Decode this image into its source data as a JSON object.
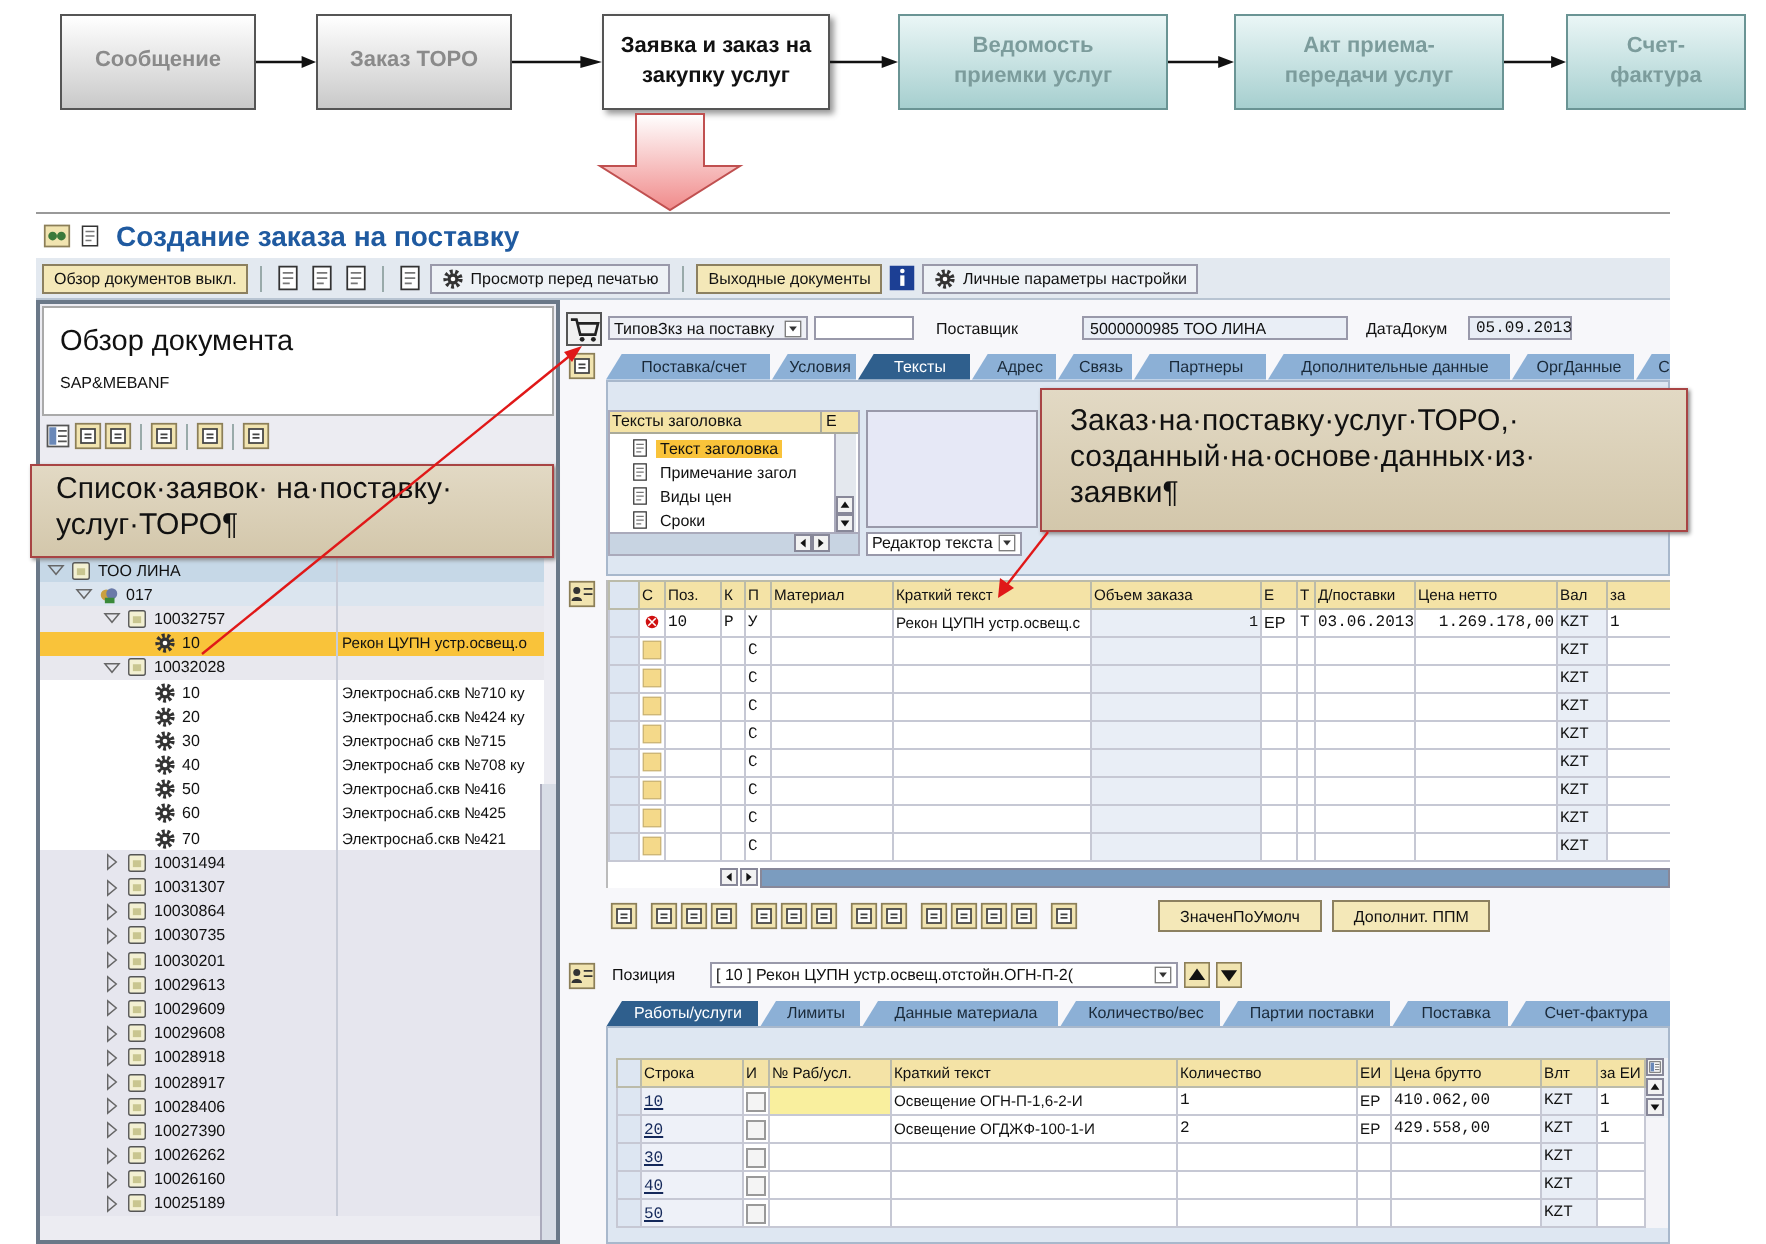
{
  "process_flow": [
    {
      "label": "Сообщение",
      "kind": "done"
    },
    {
      "label": "Заказ ТОРО",
      "kind": "done"
    },
    {
      "label": "Заявка и заказ на закупку услуг",
      "kind": "current"
    },
    {
      "label": "Ведомость приемки услуг",
      "kind": "next"
    },
    {
      "label": "Акт приема-передачи услуг",
      "kind": "next"
    },
    {
      "label": "Счет-фактура",
      "kind": "next"
    }
  ],
  "window": {
    "title": "Создание заказа на поставку"
  },
  "toolbar": [
    {
      "kind": "button",
      "label": "Обзор документов выкл."
    },
    {
      "kind": "separator"
    },
    {
      "kind": "icon"
    },
    {
      "kind": "icon"
    },
    {
      "kind": "icon"
    },
    {
      "kind": "separator"
    },
    {
      "kind": "icon"
    },
    {
      "kind": "icon_button",
      "label": "Просмотр перед печатью"
    },
    {
      "kind": "separator"
    },
    {
      "kind": "button",
      "label": "Выходные документы"
    },
    {
      "kind": "info"
    },
    {
      "kind": "icon_button",
      "label": "Личные параметры настройки"
    }
  ],
  "overview": {
    "title": "Обзор документа",
    "subtitle": "SAP&MEBANF"
  },
  "tree": [
    {
      "label": "ТОО ЛИНА",
      "kind": "vendor",
      "expanded": true,
      "children": [
        {
          "label": "017",
          "kind": "group",
          "expanded": true,
          "children": [
            {
              "label": "10032757",
              "kind": "doc",
              "expanded": true,
              "children": [
                {
                  "label": "10",
                  "kind": "item",
                  "selected": true,
                  "text": "Рекон ЦУПН устр.освещ.о"
                }
              ]
            },
            {
              "label": "10032028",
              "kind": "doc",
              "expanded": true,
              "children": [
                {
                  "label": "10",
                  "kind": "item",
                  "selected": false,
                  "text": "Электроснаб.скв №710 ку"
                },
                {
                  "label": "20",
                  "kind": "item",
                  "selected": false,
                  "text": "Электроснаб.скв №424 ку"
                },
                {
                  "label": "30",
                  "kind": "item",
                  "selected": false,
                  "text": "Электроснаб скв №715"
                },
                {
                  "label": "40",
                  "kind": "item",
                  "selected": false,
                  "text": "Электроснаб скв №708 ку"
                },
                {
                  "label": "50",
                  "kind": "item",
                  "selected": false,
                  "text": "Электроснаб.скв №416"
                },
                {
                  "label": "60",
                  "kind": "item",
                  "selected": false,
                  "text": "Электроснаб.скв №425"
                },
                {
                  "label": "70",
                  "kind": "item",
                  "selected": false,
                  "text": "Электроснаб.скв №421"
                }
              ]
            },
            {
              "label": "10031494",
              "kind": "doc",
              "expanded": false
            },
            {
              "label": "10031307",
              "kind": "doc",
              "expanded": false
            },
            {
              "label": "10030864",
              "kind": "doc",
              "expanded": false
            },
            {
              "label": "10030735",
              "kind": "doc",
              "expanded": false
            },
            {
              "label": "10030201",
              "kind": "doc",
              "expanded": false
            },
            {
              "label": "10029613",
              "kind": "doc",
              "expanded": false
            },
            {
              "label": "10029609",
              "kind": "doc",
              "expanded": false
            },
            {
              "label": "10029608",
              "kind": "doc",
              "expanded": false
            },
            {
              "label": "10028918",
              "kind": "doc",
              "expanded": false
            },
            {
              "label": "10028917",
              "kind": "doc",
              "expanded": false
            },
            {
              "label": "10028406",
              "kind": "doc",
              "expanded": false
            },
            {
              "label": "10027390",
              "kind": "doc",
              "expanded": false
            },
            {
              "label": "10026262",
              "kind": "doc",
              "expanded": false
            },
            {
              "label": "10026160",
              "kind": "doc",
              "expanded": false
            },
            {
              "label": "10025189",
              "kind": "doc",
              "expanded": false
            }
          ]
        }
      ]
    }
  ],
  "header": {
    "doc_type": "ТиповЗкз на поставку",
    "vendor_label": "Поставщик",
    "vendor": "5000000985 ТОО ЛИНА",
    "date_label": "ДатаДокум",
    "date": "05.09.2013"
  },
  "header_tabs": [
    {
      "label": "Поставка/счет",
      "selected": false
    },
    {
      "label": "Условия",
      "selected": false
    },
    {
      "label": "Тексты",
      "selected": true
    },
    {
      "label": "Адрес",
      "selected": false
    },
    {
      "label": "Связь",
      "selected": false
    },
    {
      "label": "Партнеры",
      "selected": false
    },
    {
      "label": "Дополнительные данные",
      "selected": false
    },
    {
      "label": "ОргДанные",
      "selected": false
    },
    {
      "label": "С",
      "selected": false
    }
  ],
  "header_texts": {
    "columns": [
      "Тексты заголовка",
      "Е"
    ],
    "items": [
      {
        "label": "Текст заголовка",
        "selected": true
      },
      {
        "label": "Примечание загол",
        "selected": false
      },
      {
        "label": "Виды цен",
        "selected": false
      },
      {
        "label": "Сроки",
        "selected": false
      }
    ],
    "editor": "Редактор текста"
  },
  "items_table": {
    "columns": [
      "С",
      "Поз.",
      "К",
      "П",
      "Материал",
      "Краткий текст",
      "Объем заказа",
      "Е",
      "Т",
      "Д/поставки",
      "Цена нетто",
      "Вал",
      "за"
    ],
    "rows": [
      {
        "alert": true,
        "cells": [
          "",
          "10",
          "Р",
          "У",
          "",
          "Рекон ЦУПН устр.освещ.с",
          "1",
          "ЕР",
          "Т",
          "03.06.2013",
          "1.269.178,00",
          "KZT",
          "1"
        ]
      },
      {
        "alert": false,
        "cells": [
          "",
          "",
          "",
          "С",
          "",
          "",
          "",
          "",
          "",
          "",
          "",
          "KZT",
          ""
        ]
      },
      {
        "alert": false,
        "cells": [
          "",
          "",
          "",
          "С",
          "",
          "",
          "",
          "",
          "",
          "",
          "",
          "KZT",
          ""
        ]
      },
      {
        "alert": false,
        "cells": [
          "",
          "",
          "",
          "С",
          "",
          "",
          "",
          "",
          "",
          "",
          "",
          "KZT",
          ""
        ]
      },
      {
        "alert": false,
        "cells": [
          "",
          "",
          "",
          "С",
          "",
          "",
          "",
          "",
          "",
          "",
          "",
          "KZT",
          ""
        ]
      },
      {
        "alert": false,
        "cells": [
          "",
          "",
          "",
          "С",
          "",
          "",
          "",
          "",
          "",
          "",
          "",
          "KZT",
          ""
        ]
      },
      {
        "alert": false,
        "cells": [
          "",
          "",
          "",
          "С",
          "",
          "",
          "",
          "",
          "",
          "",
          "",
          "KZT",
          ""
        ]
      },
      {
        "alert": false,
        "cells": [
          "",
          "",
          "",
          "С",
          "",
          "",
          "",
          "",
          "",
          "",
          "",
          "KZT",
          ""
        ]
      },
      {
        "alert": false,
        "cells": [
          "",
          "",
          "",
          "С",
          "",
          "",
          "",
          "",
          "",
          "",
          "",
          "KZT",
          ""
        ]
      }
    ]
  },
  "item_actions": [
    "ЗначенПоУмолч",
    "Дополнит. ППМ"
  ],
  "position": {
    "label": "Позиция",
    "value": "[ 10 ] Рекон ЦУПН устр.освещ.отстойн.ОГН-П-2("
  },
  "item_tabs": [
    {
      "label": "Работы/услуги",
      "selected": true
    },
    {
      "label": "Лимиты",
      "selected": false
    },
    {
      "label": "Данные материала",
      "selected": false
    },
    {
      "label": "Количество/вес",
      "selected": false
    },
    {
      "label": "Партии поставки",
      "selected": false
    },
    {
      "label": "Поставка",
      "selected": false
    },
    {
      "label": "Счет-фактура",
      "selected": false
    }
  ],
  "services_table": {
    "columns": [
      "Строка",
      "И",
      "№ Раб/усл.",
      "Краткий текст",
      "Количество",
      "ЕИ",
      "Цена брутто",
      "Влт",
      "за ЕИ"
    ],
    "rows": [
      {
        "checked": false,
        "editing": true,
        "cells": [
          "10",
          "",
          "",
          "Освещение ОГН-П-1,6-2-И",
          "1",
          "ЕР",
          "410.062,00",
          "KZT",
          "1"
        ]
      },
      {
        "checked": false,
        "editing": false,
        "cells": [
          "20",
          "",
          "",
          "Освещение ОГДЖФ-100-1-И",
          "2",
          "ЕР",
          "429.558,00",
          "KZT",
          "1"
        ]
      },
      {
        "checked": false,
        "editing": false,
        "cells": [
          "30",
          "",
          "",
          "",
          "",
          "",
          "",
          "KZT",
          ""
        ]
      },
      {
        "checked": false,
        "editing": false,
        "cells": [
          "40",
          "",
          "",
          "",
          "",
          "",
          "",
          "KZT",
          ""
        ]
      },
      {
        "checked": false,
        "editing": false,
        "cells": [
          "50",
          "",
          "",
          "",
          "",
          "",
          "",
          "KZT",
          ""
        ]
      }
    ]
  },
  "callouts": [
    {
      "text": "Список·заявок· на·поставку· услуг·ТОРО¶"
    },
    {
      "text": "Заказ·на·поставку·услуг·ТОРО,· созданный·на·основе·данных·из· заявки¶"
    }
  ]
}
